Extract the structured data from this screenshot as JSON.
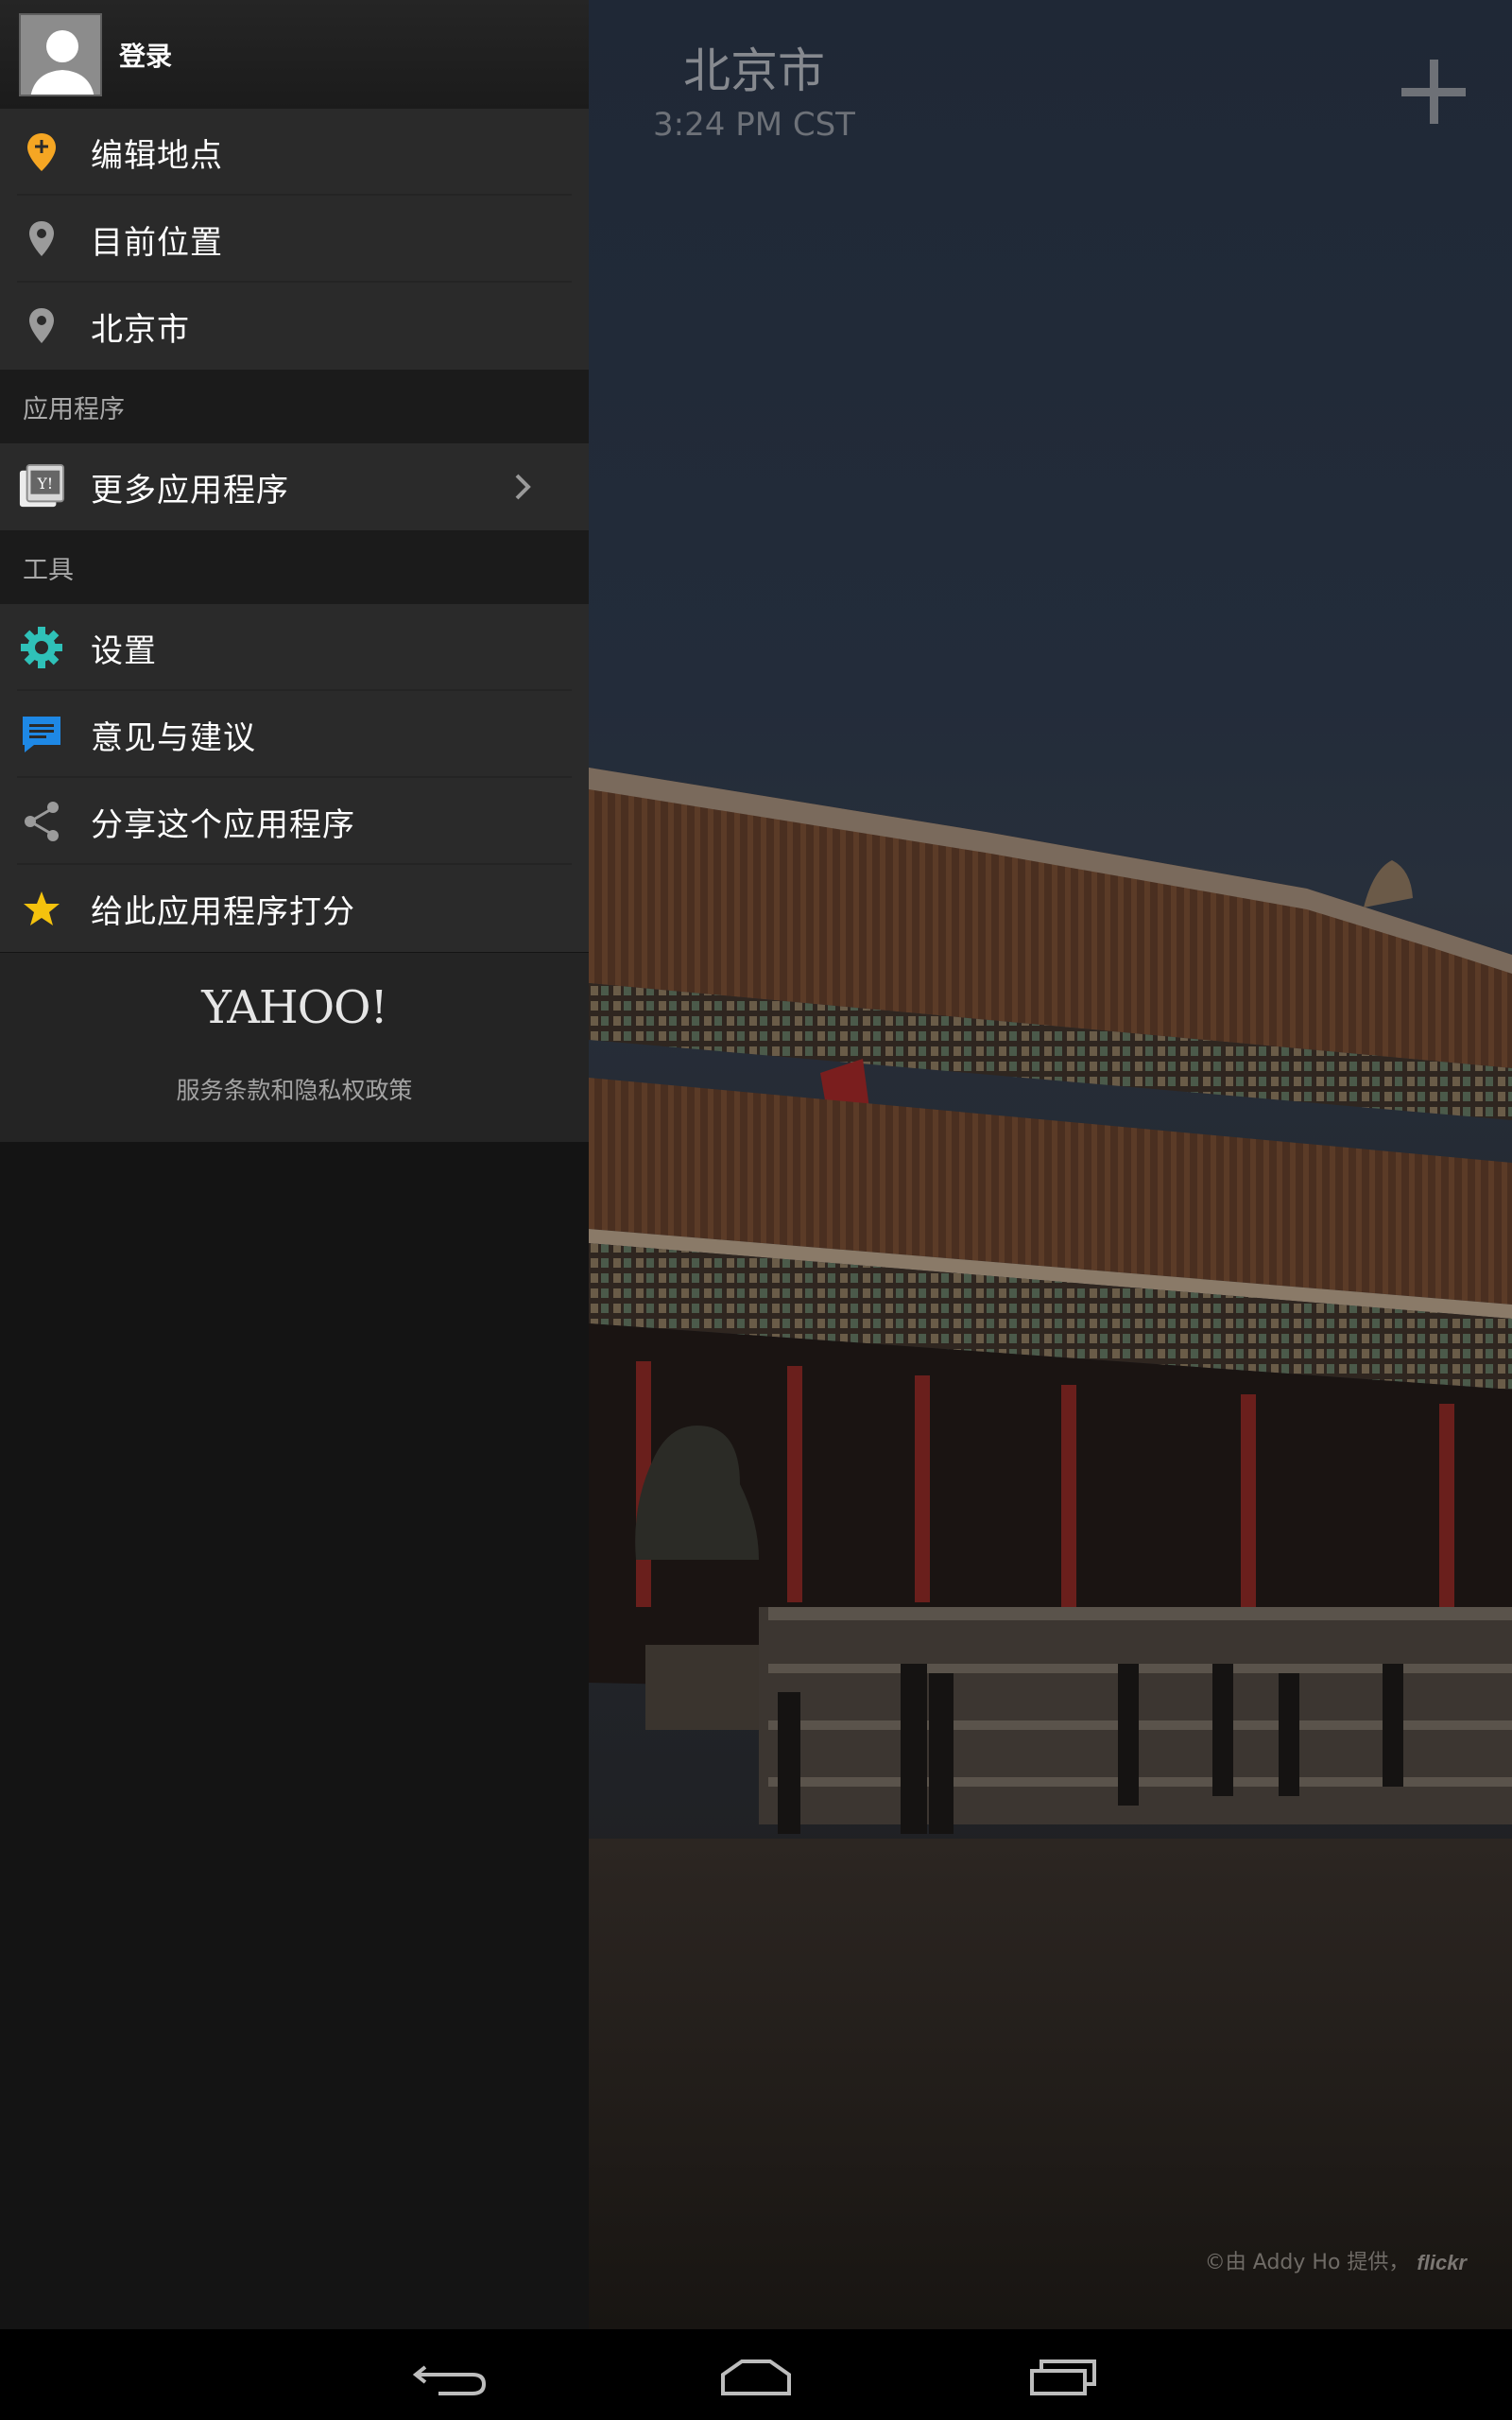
{
  "header": {
    "city": "北京市",
    "time": "3:24 PM CST",
    "add_icon": "plus-icon"
  },
  "drawer": {
    "login": {
      "label": "登录",
      "icon": "avatar"
    },
    "locations": [
      {
        "label": "编辑地点",
        "icon": "edit-pin-icon",
        "color": "#f5a623"
      },
      {
        "label": "目前位置",
        "icon": "location-pin-icon",
        "color": "#9b9b9b"
      },
      {
        "label": "北京市",
        "icon": "location-pin-icon",
        "color": "#9b9b9b"
      }
    ],
    "apps_header": "应用程序",
    "apps": [
      {
        "label": "更多应用程序",
        "icon": "yahoo-apps-icon"
      }
    ],
    "tools_header": "工具",
    "tools": [
      {
        "label": "设置",
        "icon": "gear-icon",
        "color": "#2fc1b8"
      },
      {
        "label": "意见与建议",
        "icon": "feedback-icon",
        "color": "#1e88e5"
      },
      {
        "label": "分享这个应用程序",
        "icon": "share-icon",
        "color": "#9b9b9b"
      },
      {
        "label": "给此应用程序打分",
        "icon": "star-icon",
        "color": "#f4c20d"
      }
    ],
    "footer": {
      "logo": "YAHOO!",
      "terms": "服务条款和隐私权政策"
    }
  },
  "photo_credit": {
    "text": "©由 Addy Ho 提供，",
    "brand": "flickr"
  },
  "navbar": {
    "back": "back-icon",
    "home": "home-icon",
    "recent": "recent-apps-icon"
  }
}
